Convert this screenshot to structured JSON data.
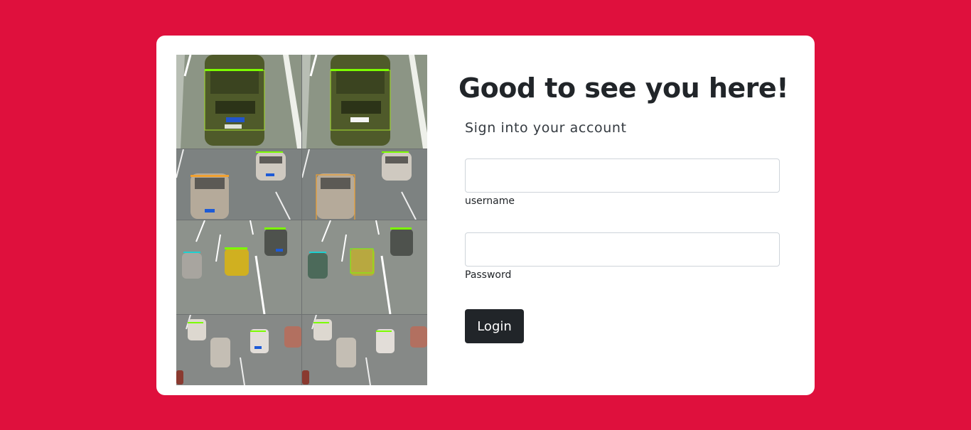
{
  "login": {
    "heading": "Good to see you here!",
    "subheading": "Sign into your account",
    "username_label": "username",
    "username_value": "",
    "password_label": "Password",
    "password_value": "",
    "button_label": "Login"
  },
  "colors": {
    "page_background": "#df103d",
    "card_background": "#ffffff",
    "button_background": "#212529",
    "detection_box_green": "#7cfc00",
    "detection_box_orange": "#f0a030",
    "license_plate_blue": "#1e5bd6"
  },
  "illustration": {
    "description_name": "vehicle-detection-mosaic"
  }
}
